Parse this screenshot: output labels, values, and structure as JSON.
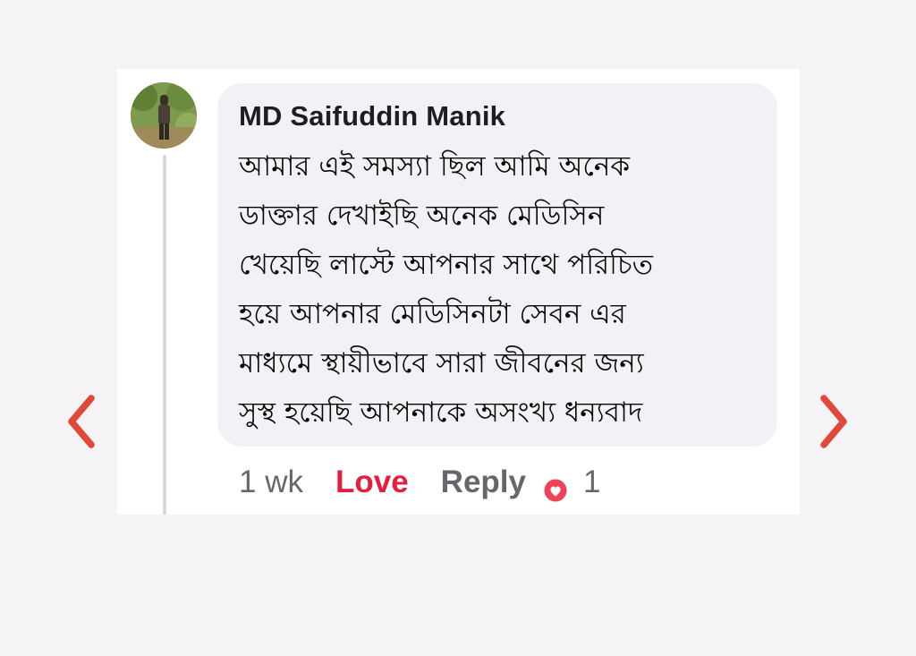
{
  "comment": {
    "author": "MD Saifuddin Manik",
    "text": "আমার এই সমস্যা ছিল আমি অনেক\nডাক্তার দেখাইছি অনেক মেডিসিন\nখেয়েছি  লাস্টে আপনার সাথে পরিচিত\nহয়ে আপনার মেডিসিনটা সেবন এর\nমাধ্যমে স্থায়ীভাবে সারা জীবনের জন্য\nসুস্থ হয়েছি আপনাকে অসংখ্য ধন্যবাদ",
    "time": "1 wk",
    "love_label": "Love",
    "reply_label": "Reply",
    "reaction_icon": "love-reaction-icon",
    "reaction_count": "1"
  },
  "navigation": {
    "prev_icon": "chevron-left-icon",
    "next_icon": "chevron-right-icon"
  },
  "colors": {
    "page_background": "#f5f3f6",
    "card_background": "#ffffff",
    "bubble_background": "#f0f2f5",
    "arrow": "#e0483a",
    "love": "#e41e3f",
    "muted_text": "#65676b"
  }
}
